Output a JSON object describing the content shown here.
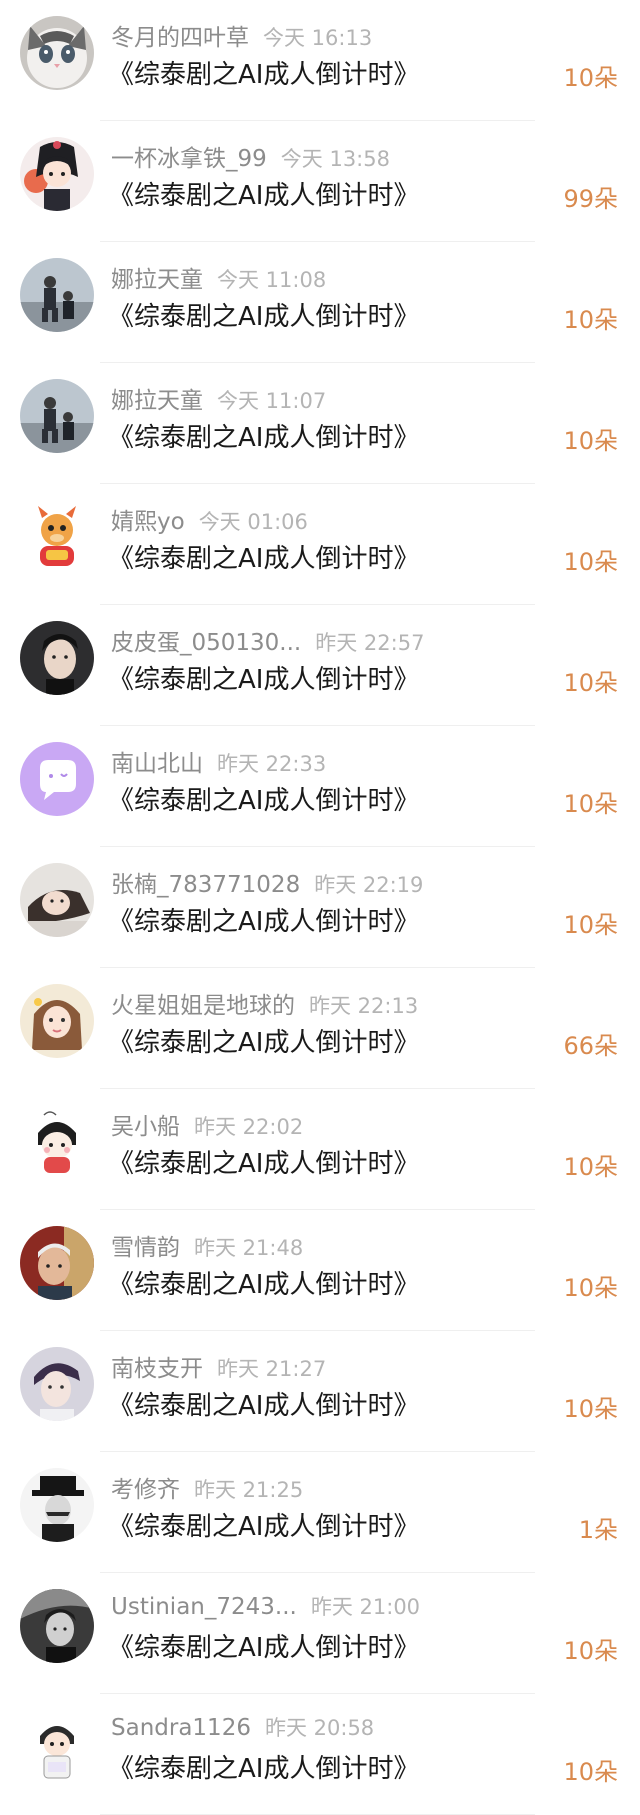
{
  "gifts": [
    {
      "name": "冬月的四叶草",
      "time": "今天 16:13",
      "title": "《综泰剧之AI成人倒计时》",
      "amount": "10朵",
      "avatar": "cat-avatar-icon"
    },
    {
      "name": "一杯冰拿铁_99",
      "time": "今天 13:58",
      "title": "《综泰剧之AI成人倒计时》",
      "amount": "99朵",
      "avatar": "anime-girl-avatar-icon"
    },
    {
      "name": "娜拉天童",
      "time": "今天 11:08",
      "title": "《综泰剧之AI成人倒计时》",
      "amount": "10朵",
      "avatar": "couple-photo-avatar-icon"
    },
    {
      "name": "娜拉天童",
      "time": "今天 11:07",
      "title": "《综泰剧之AI成人倒计时》",
      "amount": "10朵",
      "avatar": "couple-photo-avatar-icon"
    },
    {
      "name": "婧熙yo",
      "time": "今天 01:06",
      "title": "《综泰剧之AI成人倒计时》",
      "amount": "10朵",
      "avatar": "dragon-avatar-icon"
    },
    {
      "name": "皮皮蛋_050130...",
      "time": "昨天 22:57",
      "title": "《综泰剧之AI成人倒计时》",
      "amount": "10朵",
      "avatar": "man-portrait-avatar-icon"
    },
    {
      "name": "南山北山",
      "time": "昨天 22:33",
      "title": "《综泰剧之AI成人倒计时》",
      "amount": "10朵",
      "avatar": "chat-bubble-avatar-icon"
    },
    {
      "name": "张楠_783771028",
      "time": "昨天 22:19",
      "title": "《综泰剧之AI成人倒计时》",
      "amount": "10朵",
      "avatar": "woman-portrait-avatar-icon"
    },
    {
      "name": "火星姐姐是地球的",
      "time": "昨天 22:13",
      "title": "《综泰剧之AI成人倒计时》",
      "amount": "66朵",
      "avatar": "girl-portrait-avatar-icon"
    },
    {
      "name": "吴小船",
      "time": "昨天 22:02",
      "title": "《综泰剧之AI成人倒计时》",
      "amount": "10朵",
      "avatar": "cartoon-character-avatar-icon"
    },
    {
      "name": "雪情韵",
      "time": "昨天 21:48",
      "title": "《综泰剧之AI成人倒计时》",
      "amount": "10朵",
      "avatar": "man-photo-avatar-icon"
    },
    {
      "name": "南枝支开",
      "time": "昨天 21:27",
      "title": "《综泰剧之AI成人倒计时》",
      "amount": "10朵",
      "avatar": "man-portrait-avatar-icon"
    },
    {
      "name": "考修齐",
      "time": "昨天 21:25",
      "title": "《综泰剧之AI成人倒计时》",
      "amount": "1朵",
      "avatar": "man-hat-avatar-icon"
    },
    {
      "name": "Ustinian_7243...",
      "time": "昨天 21:00",
      "title": "《综泰剧之AI成人倒计时》",
      "amount": "10朵",
      "avatar": "bw-portrait-avatar-icon"
    },
    {
      "name": "Sandra1126",
      "time": "昨天 20:58",
      "title": "《综泰剧之AI成人倒计时》",
      "amount": "10朵",
      "avatar": "chibi-character-avatar-icon"
    }
  ],
  "colors": {
    "amount": "#d98a4e",
    "name": "#8c8c8c",
    "time": "#b4b4b4",
    "title": "#1a1a1a"
  }
}
